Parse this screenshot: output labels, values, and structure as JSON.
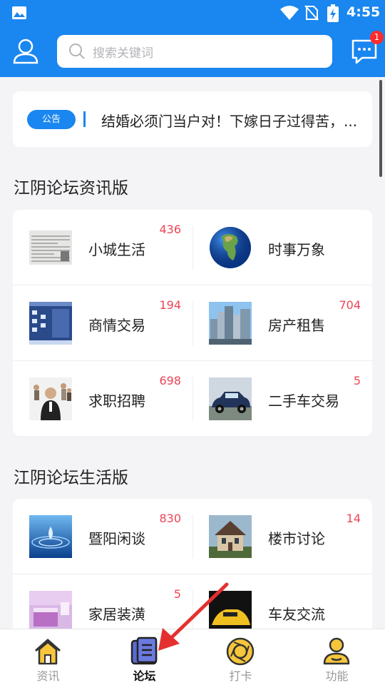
{
  "status_bar": {
    "time": "4:55"
  },
  "header": {
    "search_placeholder": "搜索关键词",
    "message_badge": "1",
    "accent_color": "#1a86f0"
  },
  "notice": {
    "tag": "公告",
    "text": "结婚必须门当户对！下嫁日子过得苦，..."
  },
  "sections": [
    {
      "title": "江阴论坛资讯版",
      "boards": [
        {
          "name": "小城生活",
          "count": "436",
          "icon": "newspaper-thumb"
        },
        {
          "name": "时事万象",
          "count": "",
          "icon": "globe-thumb"
        },
        {
          "name": "商情交易",
          "count": "194",
          "icon": "desktop-thumb"
        },
        {
          "name": "房产租售",
          "count": "704",
          "icon": "city-buildings-thumb"
        },
        {
          "name": "求职招聘",
          "count": "698",
          "icon": "business-people-thumb"
        },
        {
          "name": "二手车交易",
          "count": "5",
          "icon": "car-thumb"
        }
      ]
    },
    {
      "title": "江阴论坛生活版",
      "boards": [
        {
          "name": "暨阳闲谈",
          "count": "830",
          "icon": "water-drop-thumb"
        },
        {
          "name": "楼市讨论",
          "count": "14",
          "icon": "house-thumb"
        },
        {
          "name": "家居装潢",
          "count": "5",
          "icon": "bedroom-thumb"
        },
        {
          "name": "车友交流",
          "count": "",
          "icon": "sports-car-thumb"
        }
      ]
    }
  ],
  "tabs": [
    {
      "label": "资讯",
      "icon": "home-icon",
      "active": false
    },
    {
      "label": "论坛",
      "icon": "forum-book-icon",
      "active": true
    },
    {
      "label": "打卡",
      "icon": "aperture-icon",
      "active": false
    },
    {
      "label": "功能",
      "icon": "user-function-icon",
      "active": false
    }
  ],
  "annotation_color": "#e53030"
}
